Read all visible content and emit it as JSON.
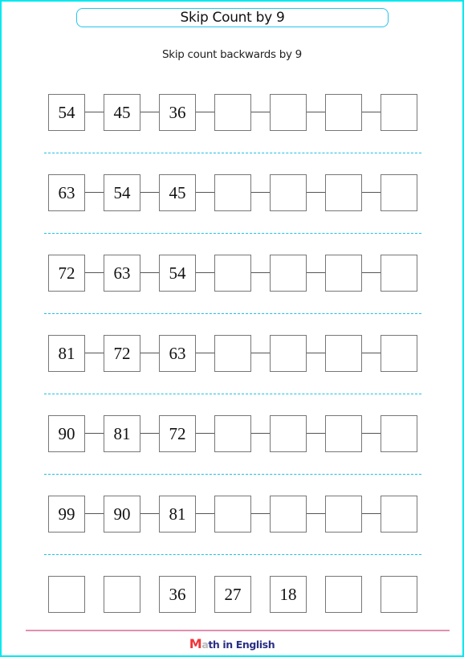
{
  "header": {
    "title": "Skip Count by 9",
    "instruction": "Skip count backwards by 9"
  },
  "rows": [
    {
      "connected": true,
      "cells": [
        "54",
        "45",
        "36",
        "",
        "",
        "",
        ""
      ]
    },
    {
      "connected": true,
      "cells": [
        "63",
        "54",
        "45",
        "",
        "",
        "",
        ""
      ]
    },
    {
      "connected": true,
      "cells": [
        "72",
        "63",
        "54",
        "",
        "",
        "",
        ""
      ]
    },
    {
      "connected": true,
      "cells": [
        "81",
        "72",
        "63",
        "",
        "",
        "",
        ""
      ]
    },
    {
      "connected": true,
      "cells": [
        "90",
        "81",
        "72",
        "",
        "",
        "",
        ""
      ]
    },
    {
      "connected": true,
      "cells": [
        "99",
        "90",
        "81",
        "",
        "",
        "",
        ""
      ]
    },
    {
      "connected": false,
      "cells": [
        "",
        "",
        "36",
        "27",
        "18",
        "",
        ""
      ]
    }
  ],
  "footer": {
    "logo_first": "M",
    "logo_second": "a",
    "logo_rest": "th in English"
  },
  "colors": {
    "page_border": "#00e8f0",
    "title_border": "#27c4ee",
    "divider": "#1ec0e8",
    "footer_line": "#e28fb0",
    "logo_m": "#f0353a",
    "logo_text": "#2a2f85"
  }
}
